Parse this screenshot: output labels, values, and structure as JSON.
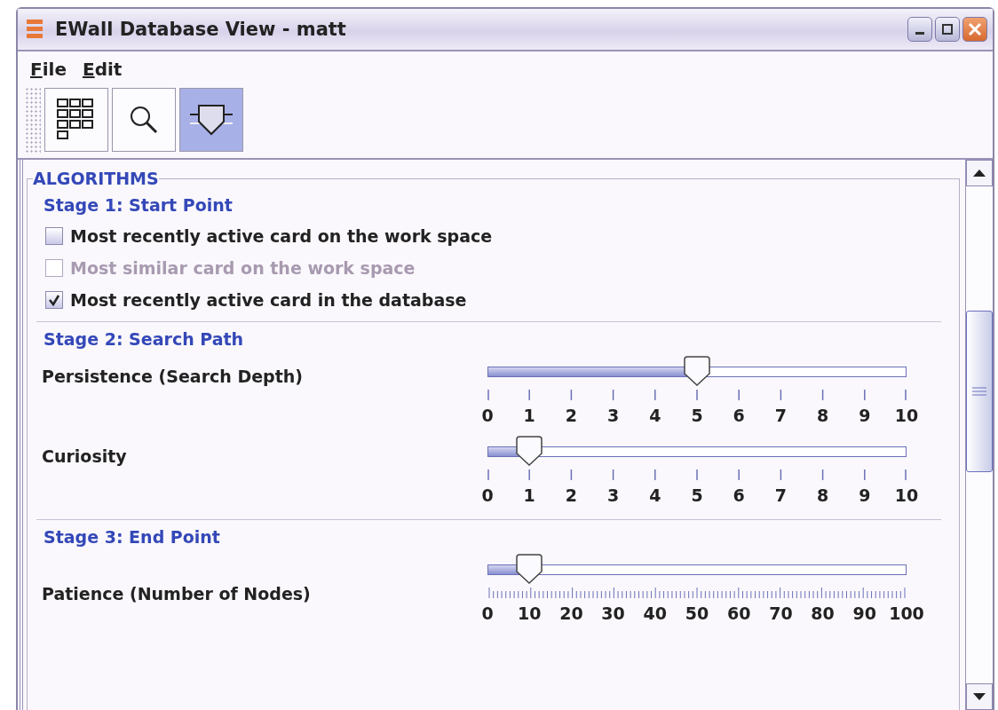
{
  "window": {
    "title": "EWall Database View - matt"
  },
  "menu": [
    {
      "label": "File"
    },
    {
      "label": "Edit"
    }
  ],
  "toolbar": [
    {
      "kind": "grid",
      "selected": false
    },
    {
      "kind": "search",
      "selected": false
    },
    {
      "kind": "funnel",
      "selected": true
    }
  ],
  "panel": {
    "title": "ALGORITHMS",
    "stages": [
      {
        "title": "Stage 1: Start Point",
        "items": [
          {
            "kind": "checkbox",
            "label": "Most recently active card on the work space",
            "checked": false,
            "disabled": false
          },
          {
            "kind": "checkbox",
            "label": "Most similar card on the work space",
            "checked": false,
            "disabled": true
          },
          {
            "kind": "checkbox",
            "label": "Most recently active card in the database",
            "checked": true,
            "disabled": false
          }
        ]
      },
      {
        "title": "Stage 2: Search Path",
        "items": [
          {
            "kind": "slider",
            "label": "Persistence (Search Depth)",
            "level": 0.5,
            "minor_ticks": false,
            "ticks": [
              "0",
              "1",
              "2",
              "3",
              "4",
              "5",
              "6",
              "7",
              "8",
              "9",
              "10"
            ]
          },
          {
            "kind": "slider",
            "label": "Curiosity",
            "level": 0.1,
            "minor_ticks": false,
            "ticks": [
              "0",
              "1",
              "2",
              "3",
              "4",
              "5",
              "6",
              "7",
              "8",
              "9",
              "10"
            ]
          }
        ]
      },
      {
        "title": "Stage 3: End Point",
        "items": [
          {
            "kind": "slider",
            "label": "Patience (Number of Nodes)",
            "level": 0.1,
            "minor_ticks": true,
            "ticks": [
              "0",
              "10",
              "20",
              "30",
              "40",
              "50",
              "60",
              "70",
              "80",
              "90",
              "100"
            ]
          }
        ]
      }
    ]
  }
}
